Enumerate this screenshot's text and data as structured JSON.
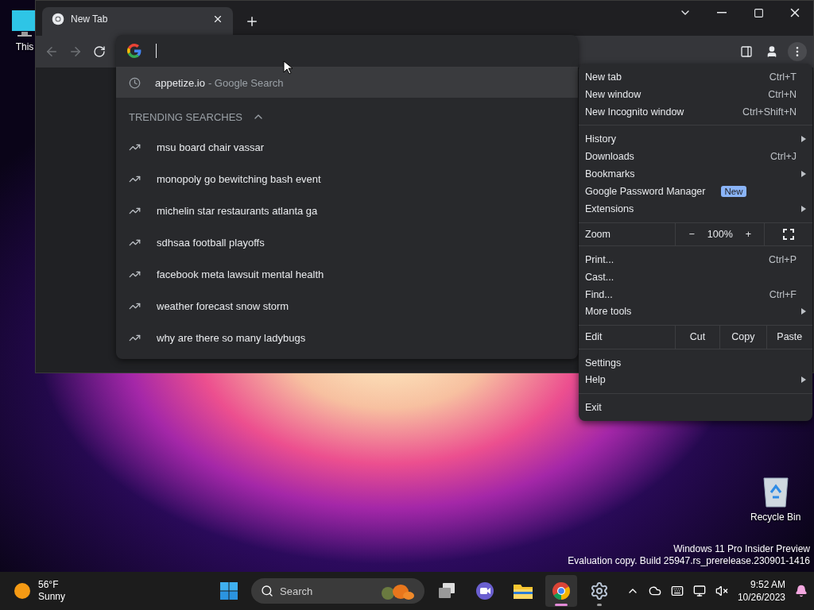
{
  "browser": {
    "tabs": [
      {
        "title": "New Tab",
        "selected": true
      }
    ],
    "omnibox": {
      "suggestions": [
        {
          "text": "appetize.io",
          "detail": "- Google Search",
          "selected": true
        }
      ],
      "trending_header": "TRENDING SEARCHES",
      "trending_expanded": true,
      "trending": [
        "msu board chair vassar",
        "monopoly go bewitching bash event",
        "michelin star restaurants atlanta ga",
        "sdhsaa football playoffs",
        "facebook meta lawsuit mental health",
        "weather forecast snow storm",
        "why are there so many ladybugs"
      ]
    }
  },
  "menu": {
    "groups": [
      [
        {
          "kind": "item",
          "label": "New tab",
          "shortcut": "Ctrl+T"
        },
        {
          "kind": "item",
          "label": "New window",
          "shortcut": "Ctrl+N"
        },
        {
          "kind": "item",
          "label": "New Incognito window",
          "shortcut": "Ctrl+Shift+N"
        }
      ],
      [
        {
          "kind": "item",
          "label": "History",
          "submenu": true
        },
        {
          "kind": "item",
          "label": "Downloads",
          "shortcut": "Ctrl+J"
        },
        {
          "kind": "item",
          "label": "Bookmarks",
          "submenu": true
        },
        {
          "kind": "item",
          "label": "Google Password Manager",
          "badge": "New"
        },
        {
          "kind": "item",
          "label": "Extensions",
          "submenu": true
        }
      ],
      [
        {
          "kind": "zoom",
          "label": "Zoom",
          "minus": "−",
          "value": "100%",
          "plus": "+"
        }
      ],
      [
        {
          "kind": "item",
          "label": "Print...",
          "shortcut": "Ctrl+P"
        },
        {
          "kind": "item",
          "label": "Cast..."
        },
        {
          "kind": "item",
          "label": "Find...",
          "shortcut": "Ctrl+F"
        },
        {
          "kind": "item",
          "label": "More tools",
          "submenu": true
        }
      ],
      [
        {
          "kind": "edit",
          "label": "Edit",
          "buttons": [
            "Cut",
            "Copy",
            "Paste"
          ]
        }
      ],
      [
        {
          "kind": "item",
          "label": "Settings"
        },
        {
          "kind": "item",
          "label": "Help",
          "submenu": true
        }
      ],
      [
        {
          "kind": "item",
          "label": "Exit"
        }
      ]
    ]
  },
  "desktop": {
    "icons": [
      {
        "kind": "pc",
        "label": "This"
      },
      {
        "kind": "recycle",
        "label": "Recycle Bin"
      }
    ],
    "watermark": [
      "Windows 11 Pro Insider Preview",
      "Evaluation copy. Build 25947.rs_prerelease.230901-1416"
    ]
  },
  "taskbar": {
    "weather": {
      "temperature": "56°F",
      "condition": "Sunny"
    },
    "search": {
      "placeholder": "Search"
    },
    "apps": [
      {
        "kind": "taskview",
        "selected": false,
        "running": false
      },
      {
        "kind": "chat",
        "selected": false,
        "running": false
      },
      {
        "kind": "files",
        "selected": false,
        "running": false
      },
      {
        "kind": "chrome",
        "selected": true,
        "running": true
      },
      {
        "kind": "settings",
        "selected": false,
        "running": true
      }
    ],
    "time": "9:52 AM",
    "date": "10/26/2023"
  }
}
